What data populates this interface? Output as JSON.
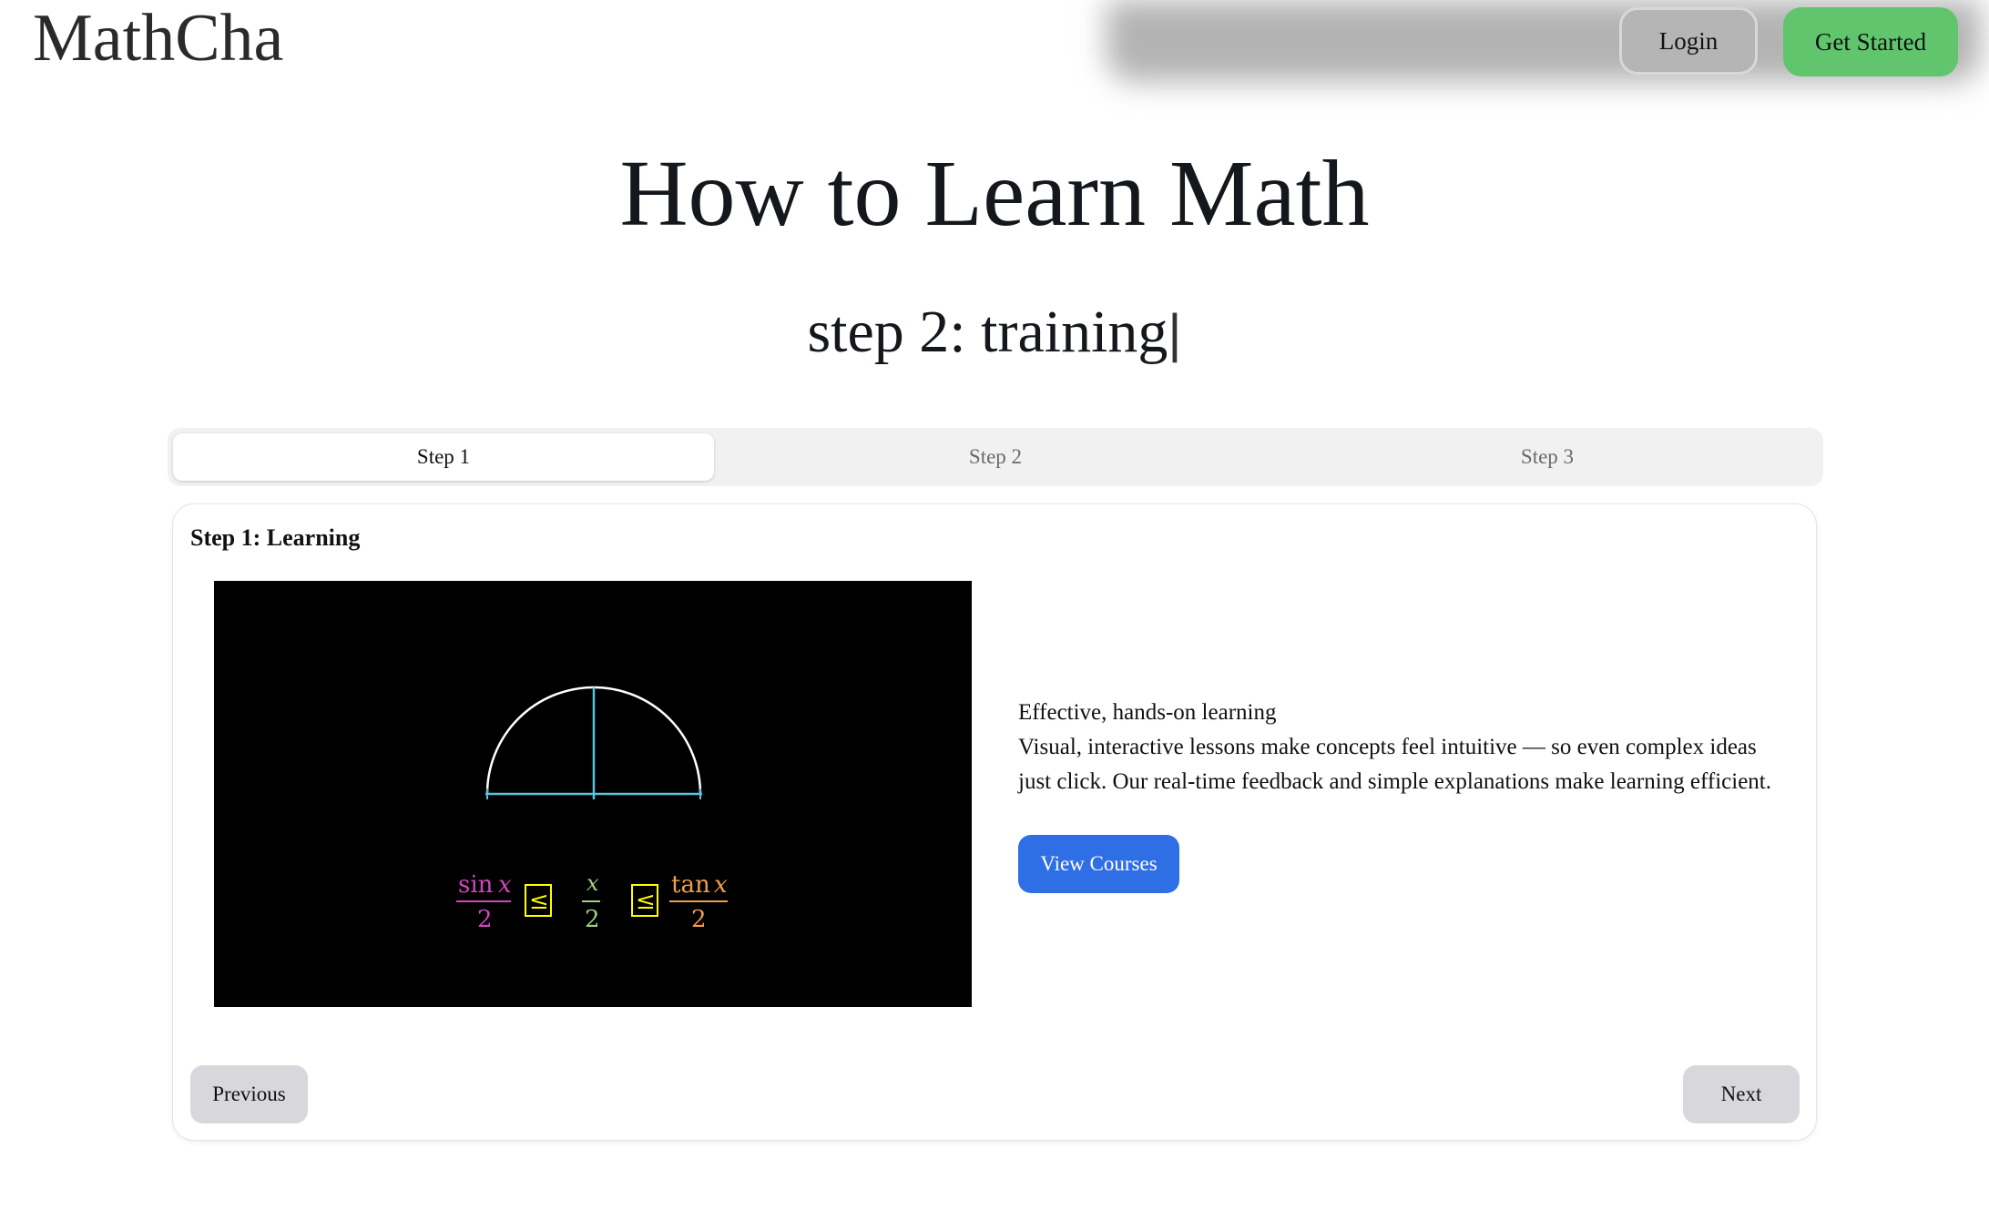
{
  "header": {
    "logo": "MathCha",
    "login_label": "Login",
    "get_started_label": "Get Started",
    "get_started_color": "#61c56d"
  },
  "hero": {
    "title": "How to Learn Math",
    "typed_text": "step 2: training",
    "cursor": "|"
  },
  "tabs": [
    {
      "label": "Step 1",
      "active": true
    },
    {
      "label": "Step 2",
      "active": false
    },
    {
      "label": "Step 3",
      "active": false
    }
  ],
  "card": {
    "title": "Step 1: Learning",
    "video": {
      "sin_num": "sin",
      "x_sym": "x",
      "tan_num": "tan",
      "denominator": "2",
      "leq": "≤"
    },
    "heading": "Effective, hands-on learning",
    "body": "Visual, interactive lessons make concepts feel intuitive — so even complex ideas just click. Our real-time feedback and simple explanations make learning efficient.",
    "cta_label": "View Courses",
    "cta_color": "#2f6fe6",
    "prev_label": "Previous",
    "next_label": "Next"
  }
}
